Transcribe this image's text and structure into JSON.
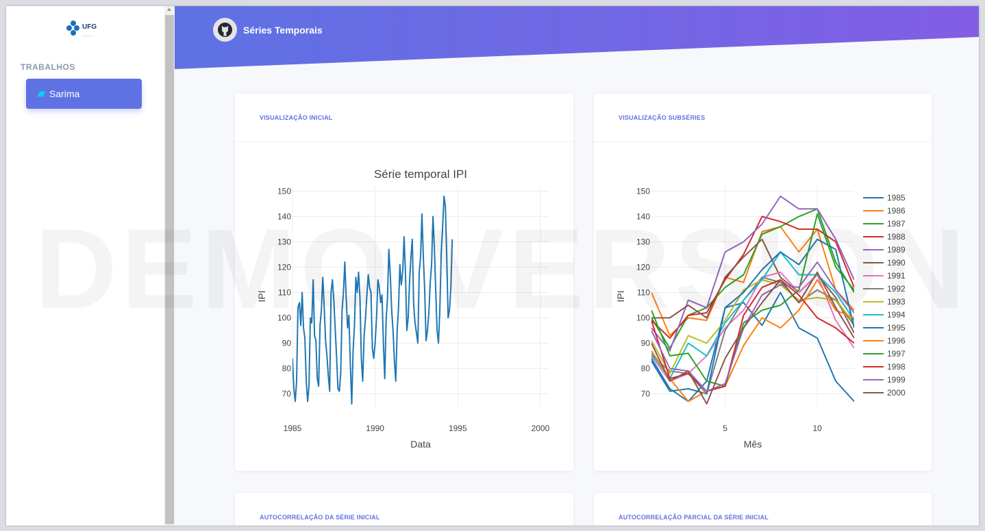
{
  "sidebar": {
    "logo_text": "UFG",
    "section_heading": "TRABALHOS",
    "items": [
      {
        "label": "Sarima",
        "icon": "planet-icon"
      }
    ]
  },
  "header": {
    "title": "Séries Temporais",
    "icon": "github-icon"
  },
  "watermark": "DEMO VERSION",
  "colors": {
    "accent": "#5e72e4",
    "header_gradient_start": "#5e72e4",
    "header_gradient_end": "#825ee4"
  },
  "cards": [
    {
      "title": "VISUALIZAÇÃO INICIAL"
    },
    {
      "title": "VISUALIZAÇÃO SUBSÉRIES"
    },
    {
      "title": "AUTOCORRELAÇÃO DA SÉRIE INICIAL"
    },
    {
      "title": "AUTOCORRELAÇÃO PARCIAL DA SÉRIE INICIAL"
    }
  ],
  "chart_data": [
    {
      "type": "line",
      "title": "Série temporal IPI",
      "xlabel": "Data",
      "ylabel": "IPI",
      "xlim": [
        1985,
        2000.5
      ],
      "ylim": [
        65,
        152
      ],
      "xticks": [
        "1985",
        "1990",
        "1995",
        "2000"
      ],
      "yticks": [
        "70",
        "80",
        "90",
        "100",
        "110",
        "120",
        "130",
        "140",
        "150"
      ],
      "grid": true,
      "series": [
        {
          "color": "#1f77b4",
          "x_start": 1985.0,
          "x_step": 0.08333,
          "values": [
            84,
            72,
            67,
            75,
            104,
            106,
            97,
            110,
            96,
            92,
            75,
            67,
            73,
            100,
            98,
            115,
            93,
            91,
            76,
            73,
            97,
            103,
            116,
            105,
            91,
            85,
            77,
            71,
            110,
            115,
            107,
            96,
            85,
            72,
            71,
            78,
            103,
            110,
            122,
            108,
            96,
            101,
            82,
            66,
            87,
            97,
            116,
            110,
            118,
            108,
            84,
            75,
            93,
            100,
            109,
            117,
            112,
            110,
            88,
            84,
            90,
            100,
            115,
            112,
            106,
            109,
            90,
            76,
            99,
            108,
            127,
            117,
            103,
            95,
            83,
            75,
            95,
            104,
            121,
            113,
            118,
            132,
            118,
            95,
            100,
            114,
            124,
            131,
            105,
            98,
            94,
            90,
            118,
            124,
            141,
            124,
            111,
            91,
            95,
            102,
            114,
            121,
            140,
            128,
            111,
            95,
            90,
            103,
            126,
            136,
            148,
            144,
            124,
            100,
            103,
            112,
            131
          ]
        }
      ]
    },
    {
      "type": "line",
      "xlabel": "Mês",
      "ylabel": "IPI",
      "xlim": [
        1,
        12
      ],
      "ylim": [
        65,
        152
      ],
      "xticks": [
        "5",
        "10"
      ],
      "yticks": [
        "70",
        "80",
        "90",
        "100",
        "110",
        "120",
        "130",
        "140",
        "150"
      ],
      "grid": true,
      "legend_position": "right",
      "series": [
        {
          "name": "1985",
          "color": "#1f77b4",
          "values": [
            84,
            72,
            67,
            75,
            104,
            106,
            97,
            110,
            96,
            92,
            75,
            67
          ]
        },
        {
          "name": "1986",
          "color": "#ff7f0e",
          "values": [
            110,
            93,
            100,
            99,
            116,
            114,
            134,
            136,
            126,
            135,
            111,
            103
          ]
        },
        {
          "name": "1987",
          "color": "#2ca02c",
          "values": [
            100,
            88,
            101,
            104,
            112,
            117,
            133,
            136,
            140,
            143,
            122,
            110
          ]
        },
        {
          "name": "1988",
          "color": "#d62728",
          "values": [
            99,
            92,
            101,
            102,
            115,
            125,
            140,
            138,
            135,
            135,
            130,
            112
          ]
        },
        {
          "name": "1989",
          "color": "#9467bd",
          "values": [
            96,
            87,
            107,
            104,
            126,
            130,
            137,
            148,
            143,
            143,
            131,
            115
          ]
        },
        {
          "name": "1990",
          "color": "#8c564b",
          "values": [
            100,
            100,
            105,
            100,
            116,
            124,
            131,
            116,
            110,
            117,
            108,
            94
          ]
        },
        {
          "name": "1991",
          "color": "#e377c2",
          "values": [
            85,
            75,
            78,
            85,
            96,
            103,
            116,
            118,
            110,
            117,
            99,
            88
          ]
        },
        {
          "name": "1992",
          "color": "#7f7f7f",
          "values": [
            85,
            79,
            78,
            70,
            95,
            107,
            116,
            114,
            106,
            111,
            107,
            97
          ]
        },
        {
          "name": "1993",
          "color": "#bcbd22",
          "values": [
            91,
            78,
            93,
            90,
            99,
            111,
            115,
            113,
            107,
            108,
            107,
            98
          ]
        },
        {
          "name": "1994",
          "color": "#17becf",
          "values": [
            86,
            76,
            90,
            85,
            98,
            107,
            115,
            126,
            117,
            117,
            110,
            99
          ]
        },
        {
          "name": "1995",
          "color": "#1f77b4",
          "values": [
            83,
            71,
            72,
            70,
            104,
            110,
            119,
            126,
            121,
            131,
            127,
            96
          ]
        },
        {
          "name": "1996",
          "color": "#ff7f0e",
          "values": [
            87,
            76,
            67,
            71,
            73,
            89,
            100,
            96,
            103,
            115,
            103,
            100
          ]
        },
        {
          "name": "1997",
          "color": "#2ca02c",
          "values": [
            103,
            85,
            86,
            75,
            73,
            98,
            103,
            105,
            111,
            141,
            120,
            111
          ]
        },
        {
          "name": "1998",
          "color": "#d62728",
          "values": [
            99,
            76,
            78,
            71,
            73,
            101,
            112,
            115,
            109,
            100,
            96,
            90
          ]
        },
        {
          "name": "1999",
          "color": "#9467bd",
          "values": [
            95,
            80,
            79,
            71,
            74,
            96,
            109,
            113,
            112,
            122,
            111,
            102
          ]
        },
        {
          "name": "2000",
          "color": "#8c564b",
          "values": [
            90,
            75,
            79,
            66,
            84,
            96,
            106,
            115,
            106,
            118,
            104,
            92
          ]
        }
      ]
    }
  ]
}
